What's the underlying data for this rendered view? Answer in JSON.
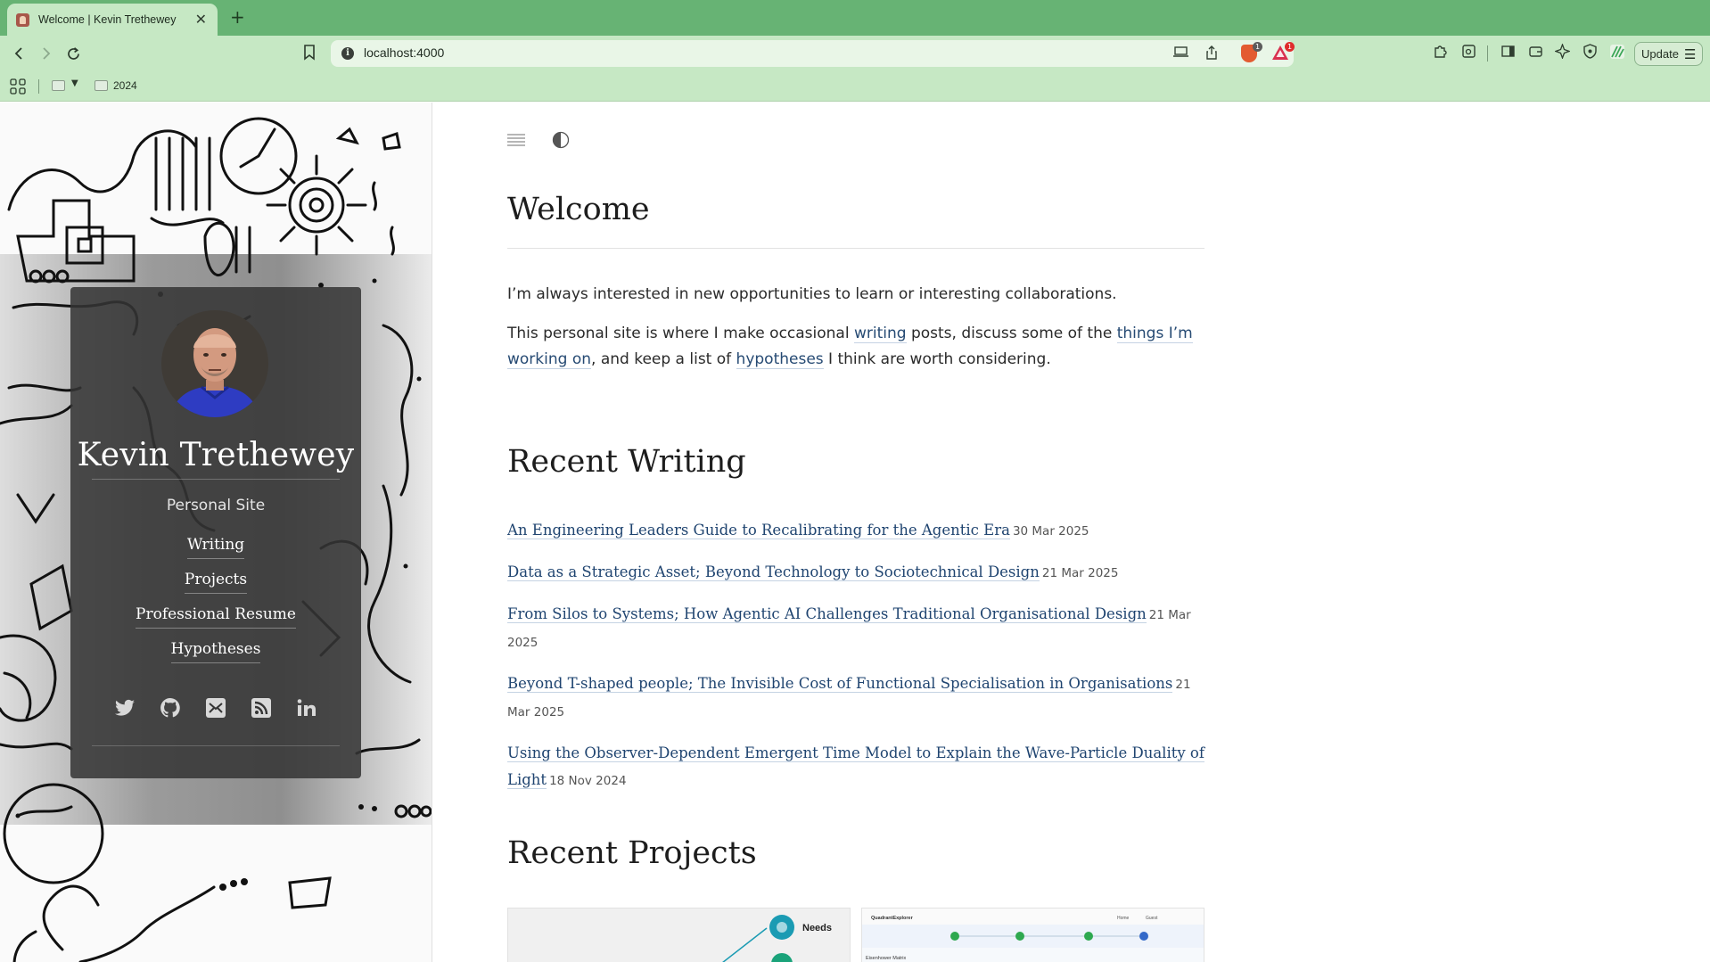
{
  "browser": {
    "tab": {
      "title": "Welcome | Kevin Trethewey"
    },
    "address_bar": {
      "url": "localhost:4000"
    },
    "update_button": {
      "label": "Update"
    },
    "extension_badges": {
      "brave_shields": "1",
      "rewards": "1"
    },
    "bookmarks": [
      {
        "label": "2024"
      }
    ]
  },
  "sidebar": {
    "name": "Kevin Trethewey",
    "subtitle": "Personal Site",
    "nav": [
      {
        "label": "Writing"
      },
      {
        "label": "Projects"
      },
      {
        "label": "Professional Resume"
      },
      {
        "label": "Hypotheses"
      }
    ],
    "social_icons": [
      "twitter-icon",
      "github-icon",
      "email-icon",
      "rss-icon",
      "linkedin-icon"
    ]
  },
  "main": {
    "title": "Welcome",
    "intro_1": "I’m always interested in new opportunities to learn or interesting collaborations.",
    "intro_2": {
      "t1": "This personal site is where I make occasional ",
      "link_writing": "writing",
      "t2": " posts, discuss some of the ",
      "link_things": "things I’m working on",
      "t3": ", and keep a list of ",
      "link_hypotheses": "hypotheses",
      "t4": " I think are worth considering."
    },
    "recent_writing_heading": "Recent Writing",
    "posts": [
      {
        "title": "An Engineering Leaders Guide to Recalibrating for the Agentic Era",
        "date": "30 Mar 2025"
      },
      {
        "title": "Data as a Strategic Asset; Beyond Technology to Sociotechnical Design",
        "date": "21 Mar 2025"
      },
      {
        "title": "From Silos to Systems; How Agentic AI Challenges Traditional Organisational Design",
        "date": "21 Mar 2025"
      },
      {
        "title": "Beyond T-shaped people; The Invisible Cost of Functional Specialisation in Organisations",
        "date": "21 Mar 2025"
      },
      {
        "title": "Using the Observer-Dependent Emergent Time Model to Explain the Wave-Particle Duality of Light",
        "date": "18 Nov 2024"
      }
    ],
    "recent_projects_heading": "Recent Projects",
    "project_thumbnails": {
      "left_label": "Needs",
      "right_app_title": "QuadrantExplorer",
      "right_tab_home": "Home",
      "right_tab_guest": "Guest",
      "right_card_heading": "Eisenhower Matrix"
    }
  },
  "colors": {
    "tabbar": "#67b374",
    "toolbar": "#c6e8c4",
    "link": "#1f4470",
    "card_bg": "#343434"
  }
}
